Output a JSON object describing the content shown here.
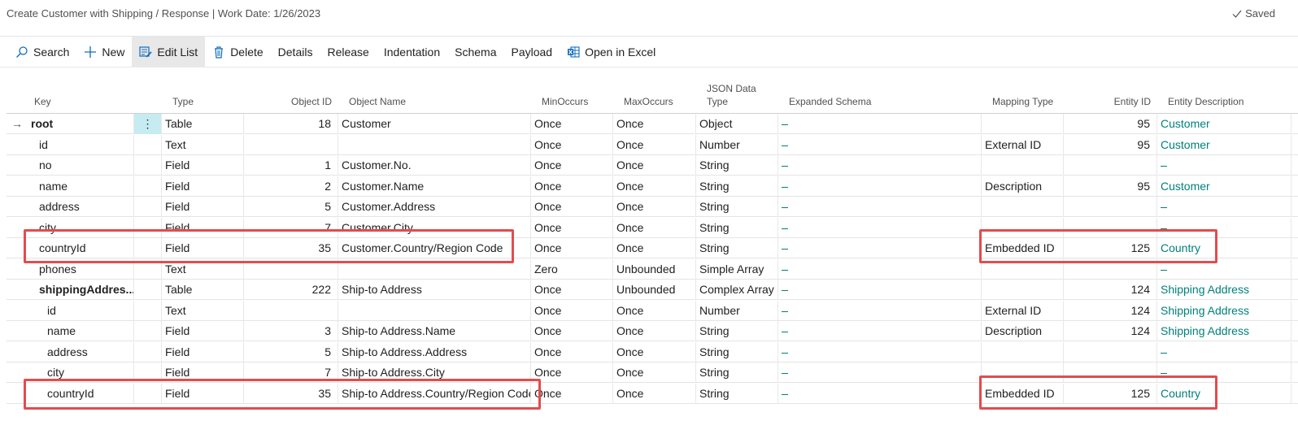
{
  "header": {
    "title": "Create Customer with Shipping / Response | Work Date: 1/26/2023",
    "saved": "Saved"
  },
  "toolbar": [
    {
      "label": "Search",
      "icon": "search-icon"
    },
    {
      "label": "New",
      "icon": "plus-icon"
    },
    {
      "label": "Edit List",
      "icon": "edit-list-icon",
      "active": true
    },
    {
      "label": "Delete",
      "icon": "trash-icon"
    },
    {
      "label": "Details"
    },
    {
      "label": "Release"
    },
    {
      "label": "Indentation"
    },
    {
      "label": "Schema"
    },
    {
      "label": "Payload"
    },
    {
      "label": "Open in Excel",
      "icon": "excel-icon"
    }
  ],
  "columns": {
    "key": "Key",
    "type": "Type",
    "object_id": "Object ID",
    "object_name": "Object Name",
    "min": "MinOccurs",
    "max": "MaxOccurs",
    "json_line1": "JSON Data",
    "json_line2": "Type",
    "expanded": "Expanded Schema",
    "mapping": "Mapping Type",
    "entity_id": "Entity ID",
    "entity_desc": "Entity Description"
  },
  "rows": [
    {
      "key": "root",
      "indent": 0,
      "bold": true,
      "current": true,
      "type": "Table",
      "object_id": "18",
      "object_name": "Customer",
      "min": "Once",
      "max": "Once",
      "json": "Object",
      "mapping": "",
      "entity_id": "95",
      "entity_desc": "Customer"
    },
    {
      "key": "id",
      "indent": 1,
      "type": "Text",
      "object_id": "",
      "object_name": "",
      "min": "Once",
      "max": "Once",
      "json": "Number",
      "mapping": "External ID",
      "entity_id": "95",
      "entity_desc": "Customer"
    },
    {
      "key": "no",
      "indent": 1,
      "type": "Field",
      "object_id": "1",
      "object_name": "Customer.No.",
      "min": "Once",
      "max": "Once",
      "json": "String",
      "mapping": "",
      "entity_id": "",
      "entity_desc": ""
    },
    {
      "key": "name",
      "indent": 1,
      "type": "Field",
      "object_id": "2",
      "object_name": "Customer.Name",
      "min": "Once",
      "max": "Once",
      "json": "String",
      "mapping": "Description",
      "entity_id": "95",
      "entity_desc": "Customer"
    },
    {
      "key": "address",
      "indent": 1,
      "type": "Field",
      "object_id": "5",
      "object_name": "Customer.Address",
      "min": "Once",
      "max": "Once",
      "json": "String",
      "mapping": "",
      "entity_id": "",
      "entity_desc": ""
    },
    {
      "key": "city",
      "indent": 1,
      "type": "Field",
      "object_id": "7",
      "object_name": "Customer.City",
      "min": "Once",
      "max": "Once",
      "json": "String",
      "mapping": "",
      "entity_id": "",
      "entity_desc": ""
    },
    {
      "key": "countryId",
      "indent": 1,
      "type": "Field",
      "object_id": "35",
      "object_name": "Customer.Country/Region Code",
      "min": "Once",
      "max": "Once",
      "json": "String",
      "mapping": "Embedded ID",
      "entity_id": "125",
      "entity_desc": "Country"
    },
    {
      "key": "phones",
      "indent": 1,
      "type": "Text",
      "object_id": "",
      "object_name": "",
      "min": "Zero",
      "max": "Unbounded",
      "json": "Simple Array",
      "mapping": "",
      "entity_id": "",
      "entity_desc": ""
    },
    {
      "key": "shippingAddres...",
      "indent": 1,
      "bold": true,
      "type": "Table",
      "object_id": "222",
      "object_name": "Ship-to Address",
      "min": "Once",
      "max": "Unbounded",
      "json": "Complex Array",
      "mapping": "",
      "entity_id": "124",
      "entity_desc": "Shipping Address"
    },
    {
      "key": "id",
      "indent": 2,
      "type": "Text",
      "object_id": "",
      "object_name": "",
      "min": "Once",
      "max": "Once",
      "json": "Number",
      "mapping": "External ID",
      "entity_id": "124",
      "entity_desc": "Shipping Address"
    },
    {
      "key": "name",
      "indent": 2,
      "type": "Field",
      "object_id": "3",
      "object_name": "Ship-to Address.Name",
      "min": "Once",
      "max": "Once",
      "json": "String",
      "mapping": "Description",
      "entity_id": "124",
      "entity_desc": "Shipping Address"
    },
    {
      "key": "address",
      "indent": 2,
      "type": "Field",
      "object_id": "5",
      "object_name": "Ship-to Address.Address",
      "min": "Once",
      "max": "Once",
      "json": "String",
      "mapping": "",
      "entity_id": "",
      "entity_desc": ""
    },
    {
      "key": "city",
      "indent": 2,
      "type": "Field",
      "object_id": "7",
      "object_name": "Ship-to Address.City",
      "min": "Once",
      "max": "Once",
      "json": "String",
      "mapping": "",
      "entity_id": "",
      "entity_desc": ""
    },
    {
      "key": "countryId",
      "indent": 2,
      "type": "Field",
      "object_id": "35",
      "object_name": "Ship-to Address.Country/Region Code",
      "min": "Once",
      "max": "Once",
      "json": "String",
      "mapping": "Embedded ID",
      "entity_id": "125",
      "entity_desc": "Country"
    }
  ],
  "colors": {
    "link": "#00807a",
    "highlight": "#e34c4c",
    "selected_cell": "#c6ecf2"
  }
}
